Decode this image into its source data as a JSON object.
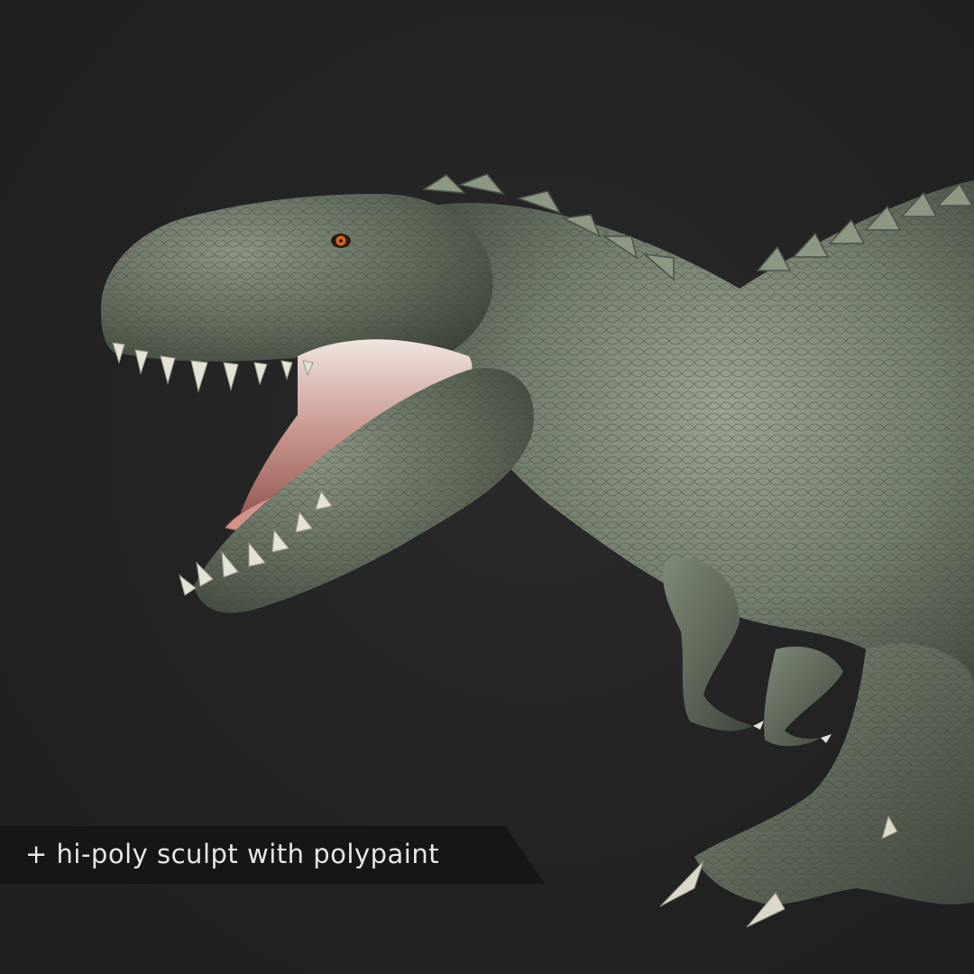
{
  "image": {
    "subject": "dinosaur-render",
    "background_color": "#232324"
  },
  "caption": {
    "text": "+ hi-poly sculpt with polypaint",
    "banner_color": "#161617",
    "text_color": "#e6e6e6"
  },
  "colors": {
    "skin": "#6f7a6a",
    "skin_dark": "#4a5348",
    "skin_light": "#9aa392",
    "mouth": "#c98a80",
    "tongue": "#d39488",
    "teeth": "#e4e2d6",
    "eye": "#d9651c"
  }
}
